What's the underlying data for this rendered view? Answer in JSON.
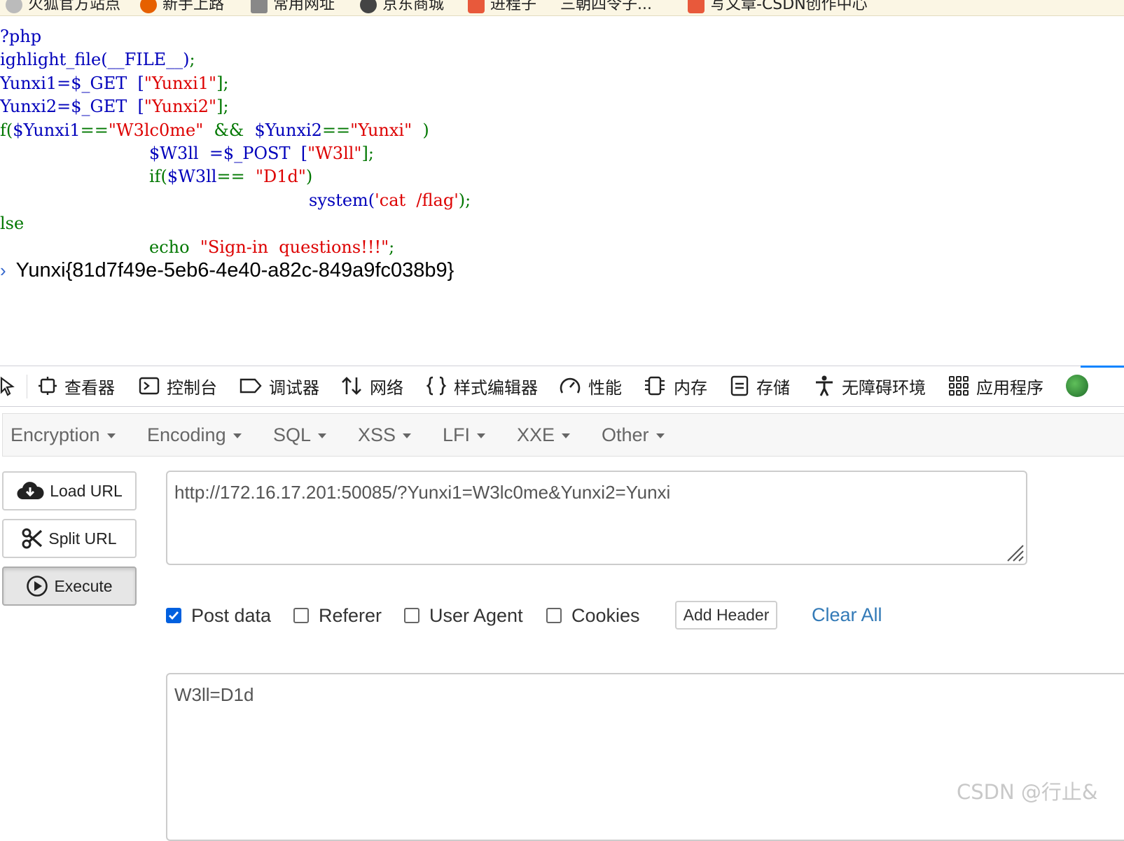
{
  "bookmarks": [
    {
      "label": "火狐官方站点",
      "color": "#e66000"
    },
    {
      "label": "新手上路",
      "color": "#e66000"
    },
    {
      "label": "常用网址",
      "color": "#555555"
    },
    {
      "label": "京东商城",
      "color": "#333333"
    },
    {
      "label": "进程子",
      "color": "#e8593b"
    },
    {
      "label": "三朝四令子...",
      "color": ""
    },
    {
      "label": "写文章-CSDN创作中心",
      "color": "#e8593b"
    }
  ],
  "source": {
    "line1": "?php",
    "line2_def": "ighlight_file(__FILE__)",
    "line2_end": ";",
    "line3_a": "Yunxi1=$_GET  [",
    "line3_str": "\"Yunxi1\"",
    "line3_b": "];",
    "line4_a": "Yunxi2=$_GET  [",
    "line4_str": "\"Yunxi2\"",
    "line4_b": "];",
    "line5_kw": "f(",
    "line5_def1": "$Yunxi1",
    "line5_kw2": "==",
    "line5_str1": "\"W3lc0me\"",
    "line5_kw3": "  &&  ",
    "line5_def2": "$Yunxi2",
    "line5_kw4": "==",
    "line5_str2": "\"Yunxi\"",
    "line5_kw5": "  )",
    "line6_def": "$W3ll  =$_POST  [",
    "line6_str": "\"W3ll\"",
    "line6_end": "];",
    "line7_kw": "if(",
    "line7_def": "$W3ll",
    "line7_kw2": "==  ",
    "line7_str": "\"D1d\"",
    "line7_kw3": ")",
    "line8_def": "system(",
    "line8_str": "'cat  /flag'",
    "line8_end": ");",
    "line9": "lse",
    "line10_kw": "echo  ",
    "line10_str": "\"Sign-in  questions!!!\"",
    "line10_end": ";"
  },
  "output": {
    "flag": "Yunxi{81d7f49e-5eb6-4e40-a82c-849a9fc038b9}"
  },
  "devtools": {
    "tabs": [
      "查看器",
      "控制台",
      "调试器",
      "网络",
      "样式编辑器",
      "性能",
      "内存",
      "存储",
      "无障碍环境",
      "应用程序"
    ]
  },
  "hackbar": {
    "menus": [
      "Encryption",
      "Encoding",
      "SQL",
      "XSS",
      "LFI",
      "XXE",
      "Other"
    ],
    "load_url": "Load URL",
    "split_url": "Split URL",
    "execute": "Execute",
    "url": "http://172.16.17.201:50085/?Yunxi1=W3lc0me&Yunxi2=Yunxi",
    "options": {
      "post_data": {
        "label": "Post data",
        "checked": true
      },
      "referer": {
        "label": "Referer",
        "checked": false
      },
      "user_agent": {
        "label": "User Agent",
        "checked": false
      },
      "cookies": {
        "label": "Cookies",
        "checked": false
      }
    },
    "add_header": "Add Header",
    "clear_all": "Clear All",
    "post_body": "W3ll=D1d"
  },
  "watermark": "CSDN @行止&",
  "colors": {
    "php_default": "#0000BB",
    "php_keyword": "#007700",
    "php_string": "#DD0000",
    "link": "#337ab7",
    "checkbox": "#0060df"
  }
}
